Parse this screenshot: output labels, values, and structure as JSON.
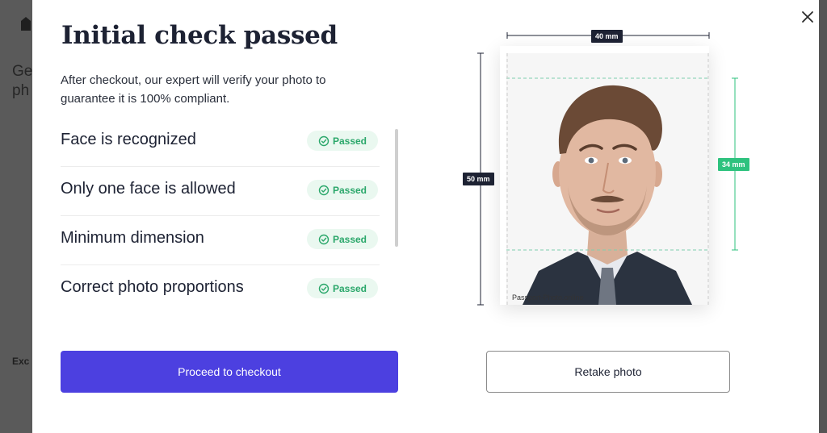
{
  "background": {
    "heading_fragment": "Ge ph",
    "footer_fragment": "Exc"
  },
  "modal": {
    "title": "Initial check passed",
    "subtitle": "After checkout, our expert will verify your photo to guarantee it is 100% compliant.",
    "checks": [
      {
        "label": "Face is recognized",
        "status": "Passed"
      },
      {
        "label": "Only one face is allowed",
        "status": "Passed"
      },
      {
        "label": "Minimum dimension",
        "status": "Passed"
      },
      {
        "label": "Correct photo proportions",
        "status": "Passed"
      }
    ],
    "preview": {
      "width_label": "40 mm",
      "height_label": "50 mm",
      "face_label": "34 mm",
      "watermark": "Passport-Photo.online"
    },
    "buttons": {
      "proceed": "Proceed to checkout",
      "retake": "Retake photo"
    },
    "close_icon": "close-icon"
  },
  "colors": {
    "primary": "#4c40e0",
    "success": "#2aa76a",
    "success_bg": "#eaf8f0",
    "dimension_dark": "#1d2233",
    "dimension_green": "#2ec27e"
  }
}
